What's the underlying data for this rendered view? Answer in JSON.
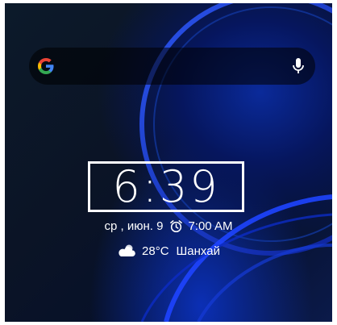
{
  "search": {
    "logo": "google-g-icon",
    "mic": "microphone-icon"
  },
  "clock": {
    "time": "6:39"
  },
  "status": {
    "date": "ср , июн. 9",
    "alarm_icon": "alarm-clock-icon",
    "alarm_time": "7:00 AM"
  },
  "weather": {
    "icon": "partly-cloudy-icon",
    "temperature": "28°C",
    "city": "Шанхай"
  },
  "colors": {
    "background": "#0b1426",
    "accent_blue": "#1a3cff",
    "text": "#ffffff"
  }
}
